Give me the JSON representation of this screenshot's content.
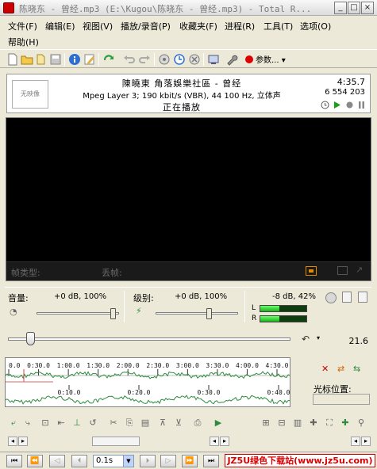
{
  "window": {
    "title": "陈晓东 - 曾经.mp3 (E:\\Kugou\\陈晓东 - 曾经.mp3) - Total R...",
    "minimize": "_",
    "maximize": "□",
    "close": "×"
  },
  "menu": {
    "file": "文件(F)",
    "edit": "编辑(E)",
    "view": "视图(V)",
    "play": "播放/录音(P)",
    "favorites": "收藏夹(F)",
    "process": "进程(R)",
    "tools": "工具(T)",
    "options": "选项(O)",
    "help": "帮助(H)"
  },
  "toolbar": {
    "params_label": "参数..."
  },
  "info": {
    "no_image": "无映像",
    "title": "陳曉東 角落娛樂社區 - 曾经",
    "format": "Mpeg Layer 3; 190 kbit/s (VBR), 44 100 Hz, 立体声",
    "status": "正在播放",
    "duration": "4:35.7",
    "samples": "6 554 203"
  },
  "video": {
    "frame_type_label": "帧类型:",
    "frame_label": "丢帧:"
  },
  "levels": {
    "volume_label": "音量:",
    "volume_value": "+0 dB, 100%",
    "level_label": "级别:",
    "level_value": "+0 dB, 100%",
    "meter_value": "-8 dB, 42%",
    "left_channel": "L",
    "right_channel": "R",
    "left_fill": 0.42,
    "right_fill": 0.42
  },
  "position": {
    "value": "21.6",
    "fraction": 0.08
  },
  "waveform": {
    "top_ticks": [
      "0.0",
      "0:30.0",
      "1:00.0",
      "1:30.0",
      "2:00.0",
      "2:30.0",
      "3:00.0",
      "3:30.0",
      "4:00.0",
      "4:30.0"
    ],
    "bottom_ticks": [
      "0:10.0",
      "0:20.0",
      "0:30.0",
      "0:40.0"
    ],
    "cursor_label": "光标位置:"
  },
  "transport": {
    "step_value": "0.1s"
  },
  "watermark": "JZ5U绿色下载站(www.jz5u.com)",
  "colors": {
    "wave": "#2e8b3e",
    "meter_green": "#3ad63a",
    "record_red": "#d00000",
    "play_green": "#1a9f1a",
    "watermark_red": "#d00000"
  }
}
